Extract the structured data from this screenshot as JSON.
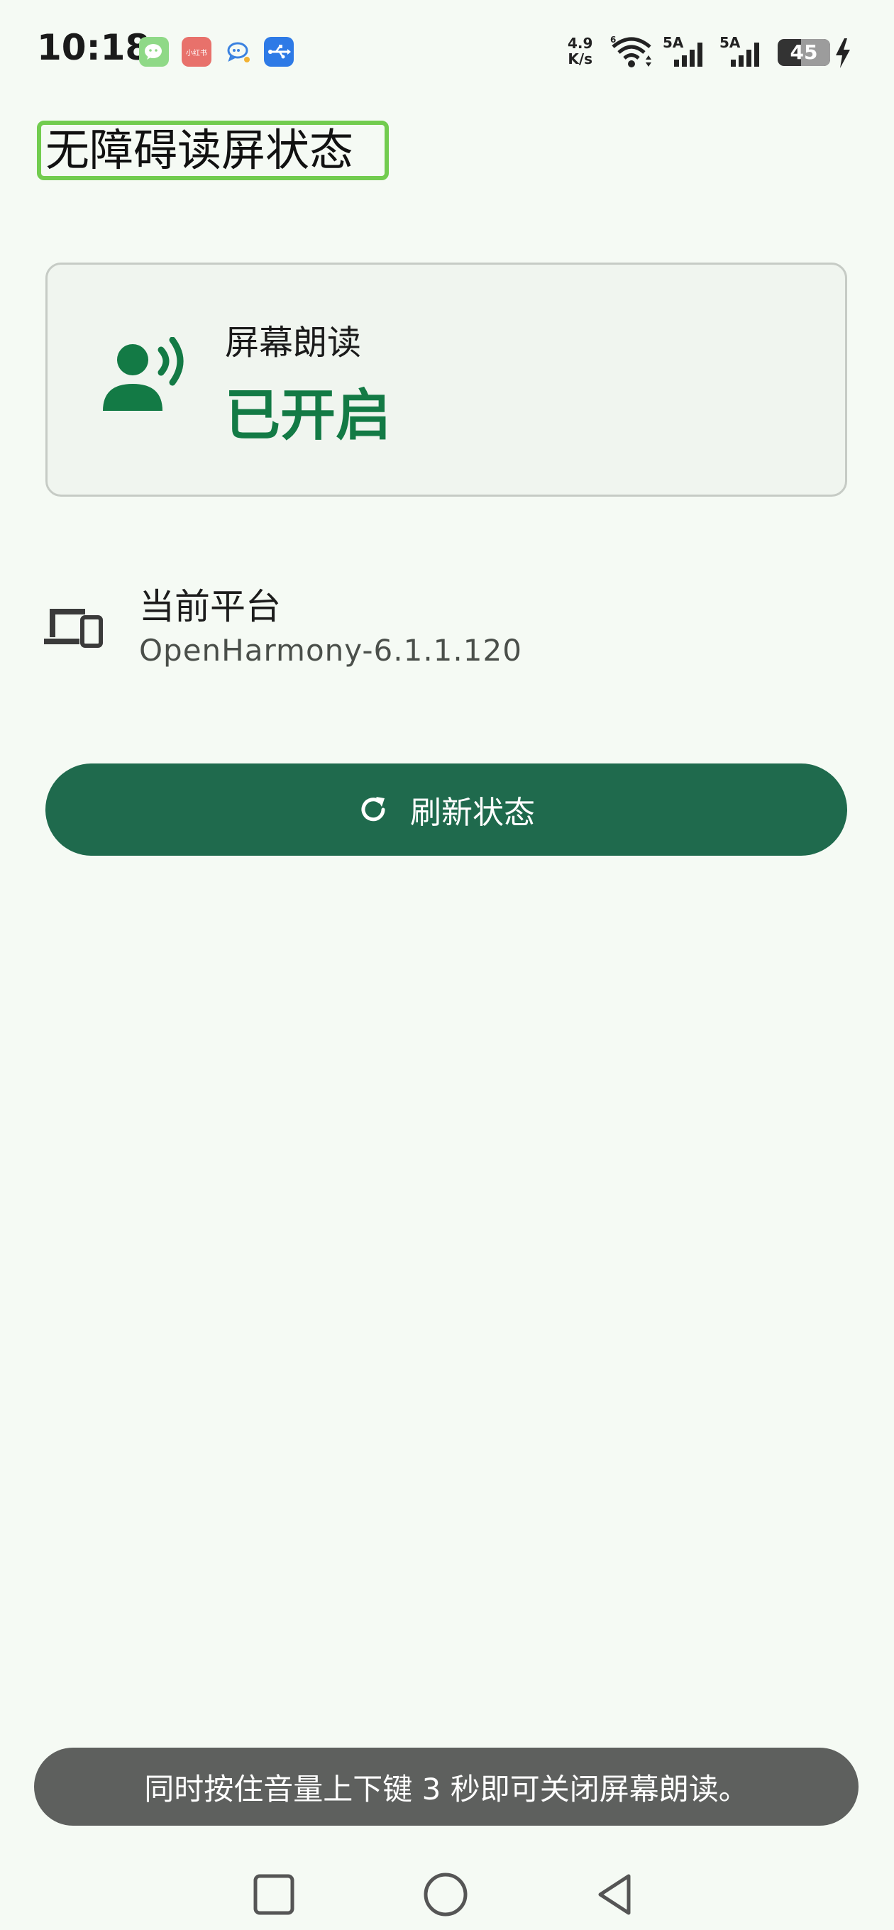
{
  "status_bar": {
    "time": "10:18",
    "net_speed_value": "4.9",
    "net_speed_unit": "K/s",
    "battery_level": "45",
    "battery_fraction": 0.45,
    "sim1_label": "5A",
    "sim2_label": "5A",
    "notification_icons": [
      "wechat-icon",
      "xiaohongshu-icon",
      "message-icon",
      "usb-icon"
    ],
    "xhs_label": "小红书"
  },
  "page": {
    "title": "无障碍读屏状态"
  },
  "reader_card": {
    "label": "屏幕朗读",
    "status": "已开启",
    "icon": "voice-person-icon",
    "status_color": "#137a45"
  },
  "platform": {
    "label": "当前平台",
    "value": "OpenHarmony-6.1.1.120",
    "icon": "devices-icon"
  },
  "refresh_button": {
    "label": "刷新状态",
    "icon": "refresh-icon",
    "color": "#1f6a4d"
  },
  "toast": {
    "message": "同时按住音量上下键 3 秒即可关闭屏幕朗读。"
  },
  "nav_bar": {
    "buttons": [
      "recents",
      "home",
      "back"
    ]
  },
  "colors": {
    "background": "#f5faf4",
    "accent": "#1f6a4d",
    "highlight_border": "#72cc4f"
  }
}
